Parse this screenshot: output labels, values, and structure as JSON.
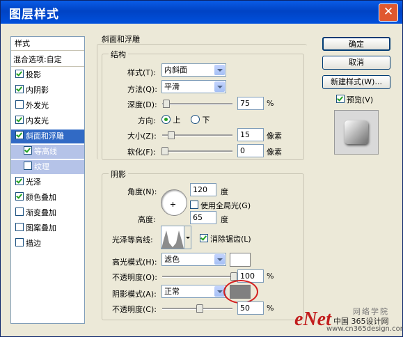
{
  "window": {
    "title": "图层样式",
    "close_label": "✕"
  },
  "sidebar": {
    "header": "样式",
    "blend_options": "混合选项:自定",
    "items": [
      {
        "label": "投影",
        "checked": true
      },
      {
        "label": "内阴影",
        "checked": true
      },
      {
        "label": "外发光",
        "checked": false
      },
      {
        "label": "内发光",
        "checked": true
      },
      {
        "label": "斜面和浮雕",
        "checked": true
      },
      {
        "label": "等高线",
        "checked": true
      },
      {
        "label": "纹理",
        "checked": false
      },
      {
        "label": "光泽",
        "checked": true
      },
      {
        "label": "颜色叠加",
        "checked": true
      },
      {
        "label": "渐变叠加",
        "checked": false
      },
      {
        "label": "图案叠加",
        "checked": false
      },
      {
        "label": "描边",
        "checked": false
      }
    ]
  },
  "bevel": {
    "section_title": "斜面和浮雕",
    "structure": {
      "title": "结构",
      "style_label": "样式(T):",
      "style_value": "内斜面",
      "technique_label": "方法(Q):",
      "technique_value": "平滑",
      "depth_label": "深度(D):",
      "depth_value": "75",
      "depth_unit": "%",
      "direction_label": "方向:",
      "direction_up": "上",
      "direction_down": "下",
      "size_label": "大小(Z):",
      "size_value": "15",
      "size_unit": "像素",
      "soften_label": "软化(F):",
      "soften_value": "0",
      "soften_unit": "像素"
    },
    "shading": {
      "title": "阴影",
      "angle_label": "角度(N):",
      "angle_value": "120",
      "angle_unit": "度",
      "global_light_label": "使用全局光(G)",
      "altitude_label": "高度:",
      "altitude_value": "65",
      "altitude_unit": "度",
      "gloss_contour_label": "光泽等高线:",
      "antialias_label": "消除锯齿(L)",
      "highlight_mode_label": "高光模式(H):",
      "highlight_mode_value": "滤色",
      "highlight_color": "#ffffff",
      "highlight_opacity_label": "不透明度(O):",
      "highlight_opacity_value": "100",
      "shadow_mode_label": "阴影模式(A):",
      "shadow_mode_value": "正常",
      "shadow_color": "#808080",
      "shadow_opacity_label": "不透明度(C):",
      "shadow_opacity_value": "50",
      "percent": "%"
    }
  },
  "buttons": {
    "ok": "确定",
    "cancel": "取消",
    "new_style": "新建样式(W)...",
    "preview": "预览(V)"
  },
  "watermark": {
    "brand": "eNet",
    "line1": "网络学院",
    "line2": "中国 365设计网",
    "line3": "www.cn365design.com"
  }
}
